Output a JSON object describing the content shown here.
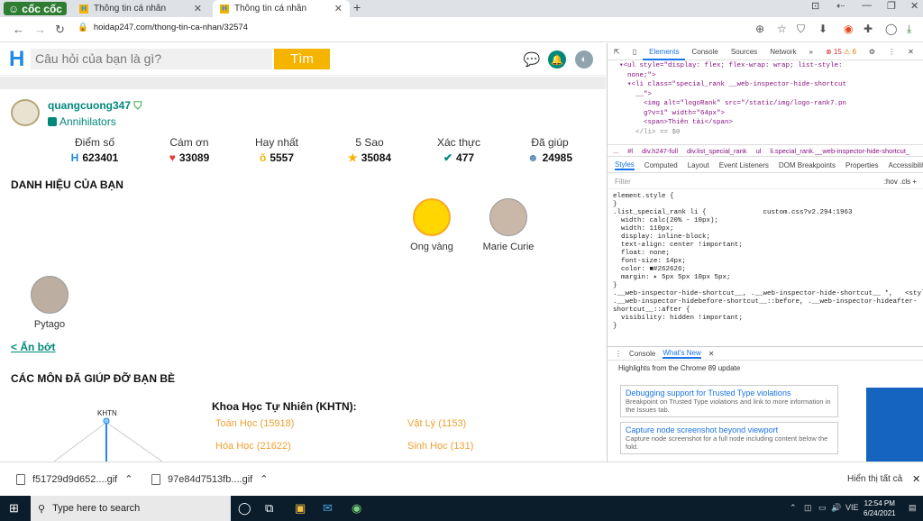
{
  "browser": {
    "brand": "cốc cốc",
    "tabs": [
      {
        "title": "Thông tin cá nhân",
        "active": false
      },
      {
        "title": "Thông tin cá nhân",
        "active": true
      }
    ],
    "url": "hoidap247.com/thong-tin-ca-nhan/32574"
  },
  "site": {
    "search_placeholder": "Câu hỏi của bạn là gì?",
    "search_button": "Tìm",
    "user": {
      "name": "quangcuong347",
      "rank": "Annihilators"
    },
    "stats": [
      {
        "label": "Điểm số",
        "value": "623401",
        "icon": "h-logo-icon"
      },
      {
        "label": "Cám ơn",
        "value": "33089",
        "icon": "heart-icon"
      },
      {
        "label": "Hay nhất",
        "value": "5557",
        "icon": "medal-icon"
      },
      {
        "label": "5 Sao",
        "value": "35084",
        "icon": "star-icon"
      },
      {
        "label": "Xác thực",
        "value": "477",
        "icon": "check-icon"
      },
      {
        "label": "Đã giúp",
        "value": "24985",
        "icon": "people-icon"
      }
    ],
    "badges_title": "DANH HIỆU CỦA BẠN",
    "badges": [
      {
        "name": "Ong vàng"
      },
      {
        "name": "Marie Curie"
      },
      {
        "name": "Pytago"
      }
    ],
    "collapse_link": "< Ẩn bớt",
    "subjects_title": "CÁC MÔN ĐÃ GIÚP ĐỠ BẠN BÈ",
    "tree_label": "KHTN",
    "subject_group": "Khoa Học Tự Nhiên (KHTN):",
    "subjects": [
      "Toán Học (15918)",
      "Vật Lý (1153)",
      "Hóa Học (21622)",
      "Sinh Học (131)"
    ]
  },
  "devtools": {
    "tabs": [
      "Elements",
      "Console",
      "Sources",
      "Network",
      "»"
    ],
    "error_count": "15",
    "warning_count": "6",
    "code_lines": [
      "  ▾<ul style=\"display: flex; flex-wrap: wrap; list-style:",
      "    none;\">",
      "    ▾<li class=\"special_rank __web-inspector-hide-shortcut",
      "      __\">",
      "        <img alt=\"logoRank\" src=\"/static/img/logo-rank7.pn",
      "        g?v=1\" width=\"64px\">",
      "        <span>Thiên tài</span>",
      "      </li> == $0"
    ],
    "breadcrumbs": [
      "...",
      "#l",
      "div.h247-full",
      "div.list_special_rank",
      "ul",
      "li.special_rank.__web-inspector-hide-shortcut_"
    ],
    "sub_tabs": [
      "Styles",
      "Computed",
      "Layout",
      "Event Listeners",
      "DOM Breakpoints",
      "Properties",
      "Accessibility"
    ],
    "filter_placeholder": "Filter",
    "filter_right": ":hov  .cls  +",
    "styles_text": "element.style {\n}\n.list_special_rank li {              custom.css?v2.294:1963\n  width: calc(20% - 10px);\n  width: 110px;\n  display: inline-block;\n  text-align: center !important;\n  float: none;\n  font-size: 14px;\n  color: ■#262626;\n  margin: ▸ 5px 5px 10px 5px;\n}\n.__web-inspector-hide-shortcut__, .__web-inspector-hide-shortcut__ *,   <style>\n.__web-inspector-hidebefore-shortcut__::before, .__web-inspector-hideafter-\nshortcut__::after {\n  visibility: hidden !important;\n}",
    "drawer_tabs": [
      "Console",
      "What's New"
    ],
    "highlights": "Highlights from the Chrome 89 update",
    "cards": [
      {
        "title": "Debugging support for Trusted Type violations",
        "desc": "Breakpoint on Trusted Type violations and link to more information in the Issues tab."
      },
      {
        "title": "Capture node screenshot beyond viewport",
        "desc": "Capture node screenshot for a full node including content below the fold."
      }
    ]
  },
  "downloads": {
    "items": [
      "f51729d9d652....gif",
      "97e84d7513fb....gif"
    ],
    "show_all": "Hiển thị tất cả"
  },
  "taskbar": {
    "search_placeholder": "Type here to search",
    "language": "VIE",
    "time": "12:54 PM",
    "date": "6/24/2021"
  },
  "colors": {
    "accent_teal": "#00897b",
    "search_button": "#f5b400",
    "subject_orange": "#f0a030"
  }
}
